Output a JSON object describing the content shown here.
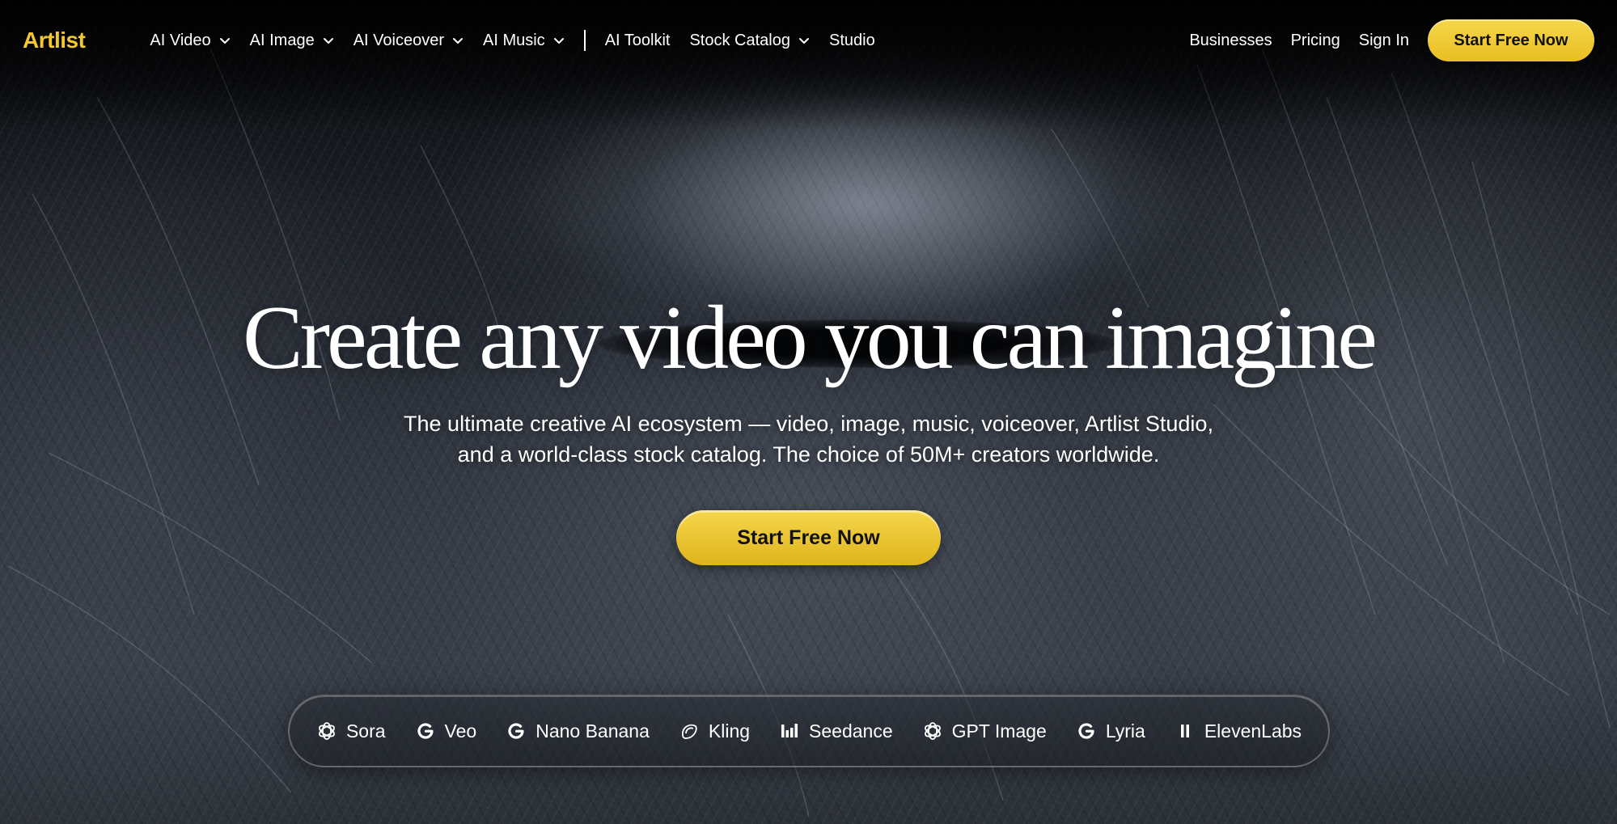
{
  "nav": {
    "logo": "Artlist",
    "items": [
      {
        "label": "AI Video",
        "dropdown": true
      },
      {
        "label": "AI Image",
        "dropdown": true
      },
      {
        "label": "AI Voiceover",
        "dropdown": true
      },
      {
        "label": "AI Music",
        "dropdown": true
      }
    ],
    "items_after_sep": [
      {
        "label": "AI Toolkit",
        "dropdown": false
      },
      {
        "label": "Stock Catalog",
        "dropdown": true
      },
      {
        "label": "Studio",
        "dropdown": false
      }
    ],
    "right": {
      "businesses": "Businesses",
      "pricing": "Pricing",
      "sign_in": "Sign In",
      "cta": "Start Free Now"
    }
  },
  "hero": {
    "headline": "Create any video you can imagine",
    "sub_line1": "The ultimate creative AI ecosystem — video, image, music, voiceover, Artlist Studio,",
    "sub_line2": "and a world-class stock catalog. The choice of 50M+ creators worldwide.",
    "cta": "Start Free Now"
  },
  "models": [
    {
      "label": "Sora",
      "icon": "openai-icon"
    },
    {
      "label": "Veo",
      "icon": "google-icon"
    },
    {
      "label": "Nano Banana",
      "icon": "google-icon"
    },
    {
      "label": "Kling",
      "icon": "kling-icon"
    },
    {
      "label": "Seedance",
      "icon": "seedance-bars-icon"
    },
    {
      "label": "GPT Image",
      "icon": "openai-icon"
    },
    {
      "label": "Lyria",
      "icon": "google-icon"
    },
    {
      "label": "ElevenLabs",
      "icon": "elevenlabs-icon"
    }
  ],
  "colors": {
    "accent": "#f4c92f",
    "button_gradient_top": "#f6d64b",
    "button_gradient_bottom": "#e8bf22",
    "text": "#ffffff",
    "background": "#0b0d10"
  }
}
